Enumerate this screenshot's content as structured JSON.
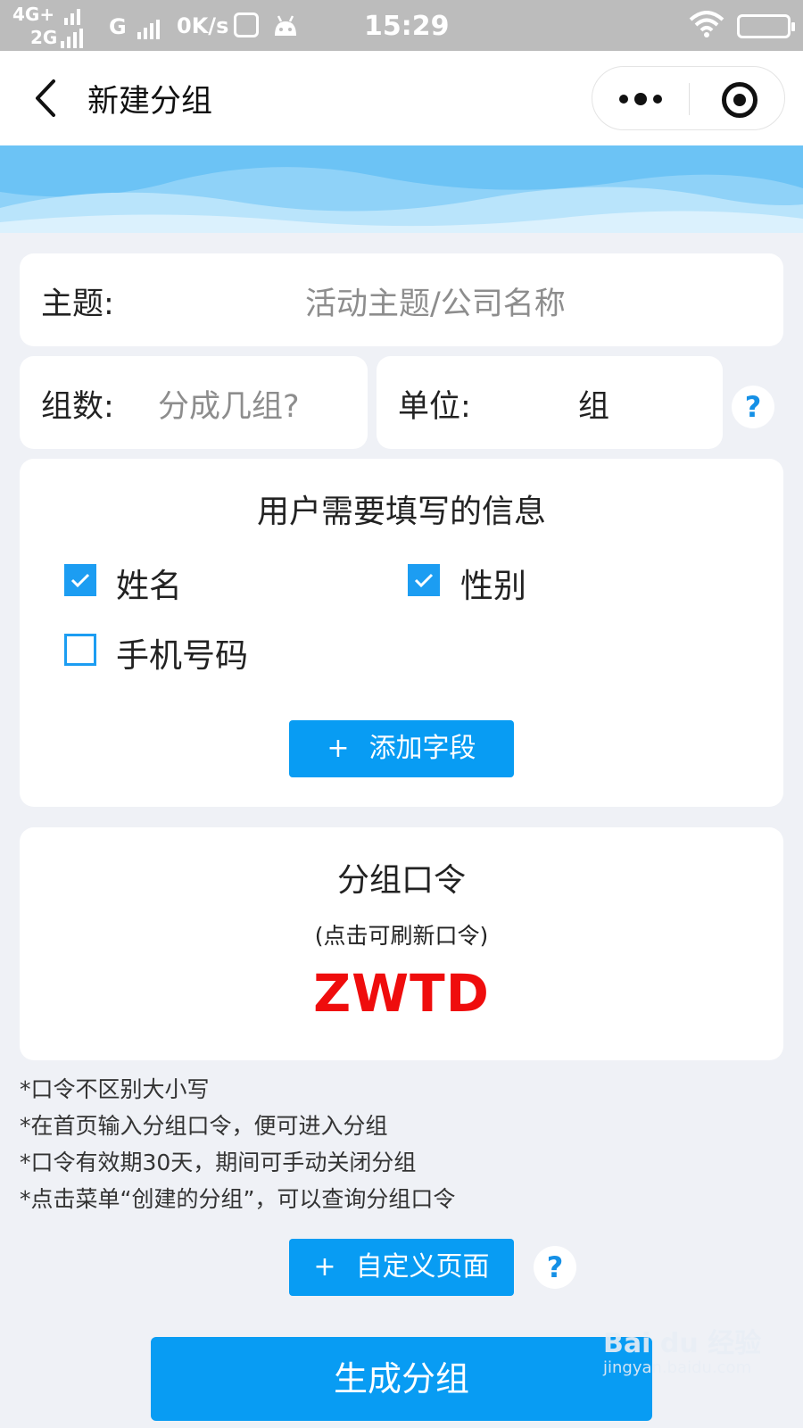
{
  "status_bar": {
    "network_top": "4G+",
    "network_bottom": "2G",
    "carrier2": "G",
    "speed": "0K/s",
    "time": "15:29"
  },
  "nav": {
    "title": "新建分组"
  },
  "form": {
    "topic_label": "主题:",
    "topic_placeholder": "活动主题/公司名称",
    "groups_label": "组数:",
    "groups_placeholder": "分成几组?",
    "unit_label": "单位:",
    "unit_value": "组",
    "help_glyph": "?"
  },
  "user_info": {
    "title": "用户需要填写的信息",
    "fields": [
      {
        "label": "姓名",
        "checked": true
      },
      {
        "label": "性别",
        "checked": true
      },
      {
        "label": "手机号码",
        "checked": false
      }
    ],
    "add_field_plus": "+",
    "add_field_label": "添加字段"
  },
  "password": {
    "title": "分组口令",
    "hint": "(点击可刷新口令)",
    "code": "ZWTD"
  },
  "notes": [
    "*口令不区别大小写",
    "*在首页输入分组口令，便可进入分组",
    "*口令有效期30天，期间可手动关闭分组",
    "*点击菜单“创建的分组”，可以查询分组口令"
  ],
  "custom_page": {
    "plus": "+",
    "label": "自定义页面"
  },
  "generate_label": "生成分组",
  "watermark": {
    "brand": "Bai du 经验",
    "url": "jingyan.baidu.com"
  },
  "colors": {
    "accent": "#089cf3",
    "code_red": "#ef0d0d",
    "checkbox": "#1c9df2",
    "page_bg": "#eff1f6"
  }
}
